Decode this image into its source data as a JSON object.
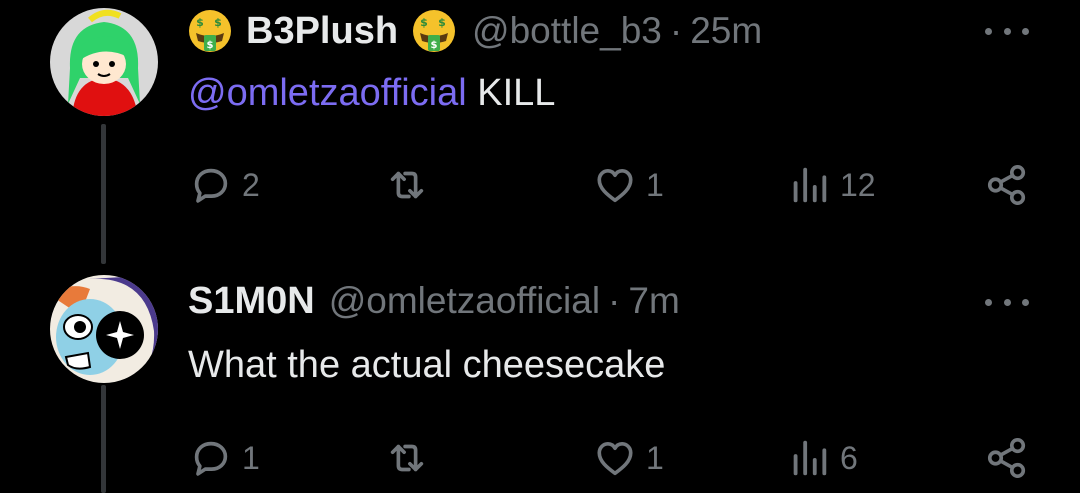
{
  "posts": [
    {
      "name": "B3Plush",
      "handle": "@bottle_b3",
      "sep": "·",
      "time": "25m",
      "mention": "@omletzaofficial",
      "text": "KILL",
      "name_emoji": "money-mouth-face",
      "replies": "2",
      "reposts": "",
      "likes": "1",
      "views": "12"
    },
    {
      "name": "S1M0N",
      "handle": "@omletzaofficial",
      "sep": "·",
      "time": "7m",
      "text": "What the actual cheesecake",
      "replies": "1",
      "reposts": "",
      "likes": "1",
      "views": "6"
    }
  ],
  "colors": {
    "background": "#000000",
    "text": "#e7e9ea",
    "secondary": "#71767b",
    "mention": "#7c6cf2",
    "thread_line": "#333639"
  },
  "icons": [
    "reply-icon",
    "repost-icon",
    "like-icon",
    "views-icon",
    "share-icon",
    "more-icon",
    "money-mouth-face-icon"
  ]
}
